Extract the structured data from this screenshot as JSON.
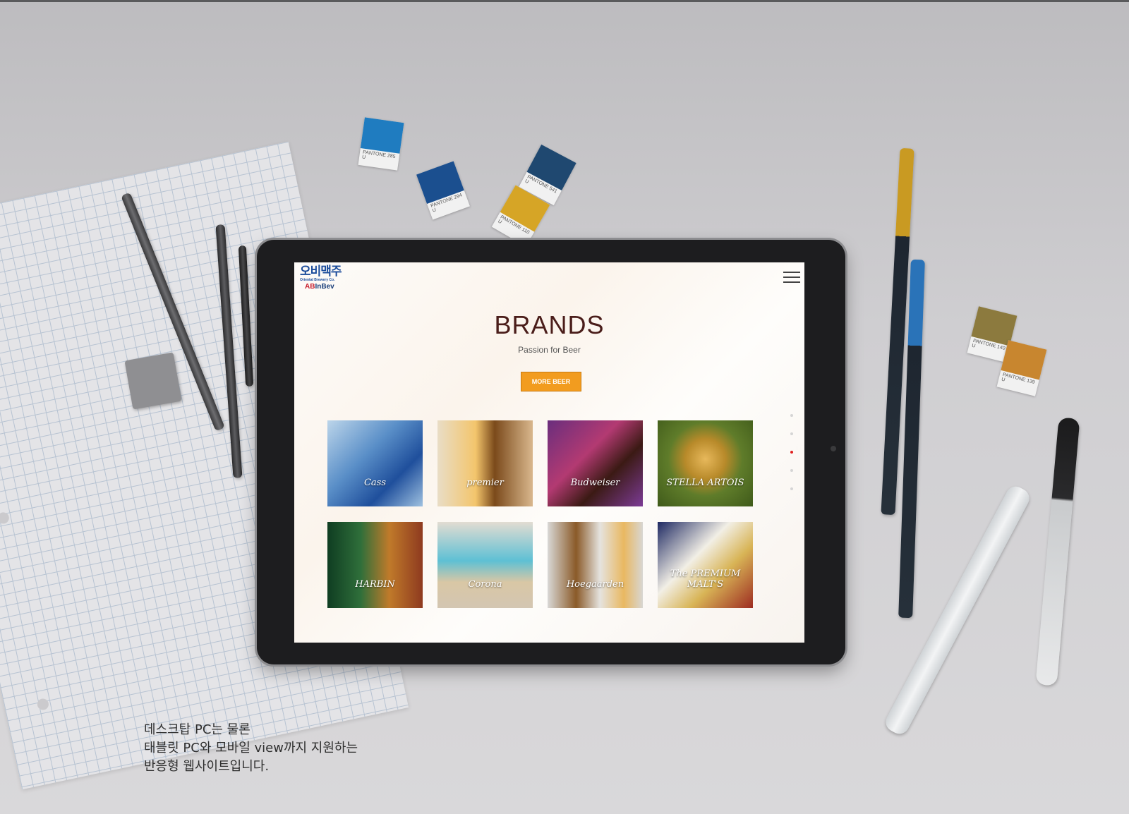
{
  "site": {
    "logo_korean": "오비맥주",
    "logo_sub": "Oriental Brewery Co.",
    "logo_ab_red": "AB",
    "logo_ab_rest": "InBev"
  },
  "hero": {
    "title": "BRANDS",
    "subtitle": "Passion for Beer",
    "button_label": "MORE BEER"
  },
  "gallery": {
    "items": [
      {
        "label": "Cass",
        "color": "#1f4f9c"
      },
      {
        "label": "premier",
        "color": "#7b4a1b"
      },
      {
        "label": "Budweiser",
        "color": "#b33a72"
      },
      {
        "label": "STELLA ARTOIS",
        "color": "#5f7c2a"
      },
      {
        "label": "HARBIN",
        "color": "#2f6f3a"
      },
      {
        "label": "Corona",
        "color": "#5ec0d4"
      },
      {
        "label": "Hoegaarden",
        "color": "#e9b861"
      },
      {
        "label": "The PREMIUM MALT'S",
        "color": "#1f2a63"
      }
    ],
    "page_count": 5,
    "active_page": 3
  },
  "caption": {
    "line1": "데스크탑 PC는 물론",
    "line2": "태블릿 PC와 모바일 view까지 지원하는",
    "line3": "반응형 웹사이트입니다."
  },
  "swatches": [
    {
      "label": "PANTONE 285 U",
      "color": "#1f7cc0"
    },
    {
      "label": "PANTONE 294 U",
      "color": "#1b4f8f"
    },
    {
      "label": "PANTONE 541 U",
      "color": "#1f4870"
    },
    {
      "label": "PANTONE 110 U",
      "color": "#d6a526"
    },
    {
      "label": "PANTONE 140 U",
      "color": "#8c7a3e"
    },
    {
      "label": "PANTONE 139 U",
      "color": "#c8862f"
    }
  ],
  "colors": {
    "accent": "#f29c1f",
    "title": "#4a1d1a",
    "active_dot": "#e02020"
  }
}
